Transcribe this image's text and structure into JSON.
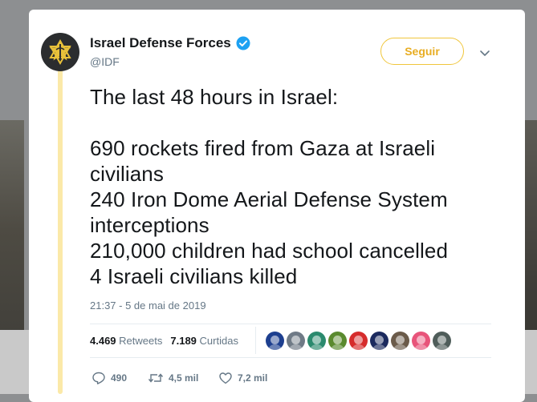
{
  "tweet": {
    "account_name": "Israel Defense Forces",
    "handle": "@IDF",
    "follow_label": "Seguir",
    "text_lines": [
      "The last 48 hours in Israel:",
      "",
      "690 rockets fired from Gaza at Israeli",
      "civilians",
      "240 Iron Dome Aerial Defense System",
      "interceptions",
      "210,000 children had school cancelled",
      "4 Israeli civilians killed"
    ],
    "timestamp": "21:37 - 5 de mai de 2019",
    "stats": {
      "retweets_count": "4.469",
      "retweets_label": "Retweets",
      "likes_count": "7.189",
      "likes_label": "Curtidas"
    },
    "actions": {
      "replies": "490",
      "retweets": "4,5 mil",
      "likes": "7,2 mil"
    },
    "liker_avatars": [
      {
        "name": "liker-avatar-flag",
        "color": "#1d3f8f"
      },
      {
        "name": "liker-avatar-2",
        "color": "#6f7a86"
      },
      {
        "name": "liker-avatar-3",
        "color": "#2b8a6e"
      },
      {
        "name": "liker-avatar-4",
        "color": "#5a8a2e"
      },
      {
        "name": "liker-avatar-5",
        "color": "#d62c2c"
      },
      {
        "name": "liker-avatar-6",
        "color": "#1b2a5e"
      },
      {
        "name": "liker-avatar-7",
        "color": "#6b5b4a"
      },
      {
        "name": "liker-avatar-8",
        "color": "#e8547a"
      },
      {
        "name": "liker-avatar-9",
        "color": "#4f5d5a"
      }
    ]
  },
  "colors": {
    "brand_gold": "#e8ad22",
    "thread_line": "#fbe9a8",
    "verified_blue": "#1da1f2",
    "text_primary": "#14171a",
    "text_secondary": "#657786"
  },
  "icons": {
    "verified": "verified-badge-icon",
    "caret": "chevron-down-icon",
    "reply": "reply-icon",
    "retweet": "retweet-icon",
    "like": "heart-icon",
    "avatar": "idf-emblem-icon"
  }
}
